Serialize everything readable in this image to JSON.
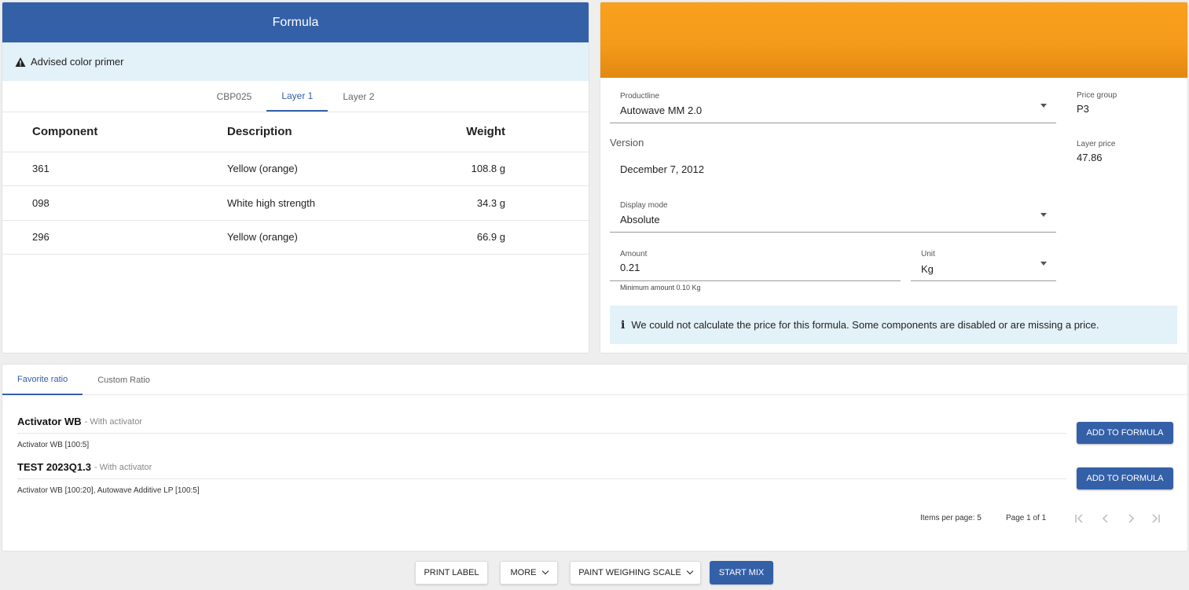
{
  "formula": {
    "title": "Formula",
    "alert": "Advised color primer",
    "tabs": [
      "CBP025",
      "Layer 1",
      "Layer 2"
    ],
    "active_tab": "Layer 1",
    "columns": [
      "Component",
      "Description",
      "Weight"
    ],
    "rows": [
      {
        "component": "361",
        "description": "Yellow (orange)",
        "weight": "108.8 g"
      },
      {
        "component": "098",
        "description": "White high strength",
        "weight": "34.3 g"
      },
      {
        "component": "296",
        "description": "Yellow (orange)",
        "weight": "66.9 g"
      }
    ]
  },
  "settings": {
    "swatch_color": "#f49b1a",
    "productline_label": "Productline",
    "productline_value": "Autowave MM 2.0",
    "version_label": "Version",
    "version_value": "December 7, 2012",
    "display_mode_label": "Display mode",
    "display_mode_value": "Absolute",
    "amount_label": "Amount",
    "amount_value": "0.21",
    "unit_label": "Unit",
    "unit_value": "Kg",
    "min_amount_hint": "Minimum amount 0.10 Kg",
    "price_group_label": "Price group",
    "price_group_value": "P3",
    "layer_price_label": "Layer price",
    "layer_price_value": "47.86",
    "info_message": "We could not calculate the price for this formula. Some components are disabled or are missing a price."
  },
  "ratios": {
    "tabs": [
      "Favorite ratio",
      "Custom Ratio"
    ],
    "active_tab": "Favorite ratio",
    "items": [
      {
        "name": "Activator WB",
        "subtitle": "- With activator",
        "detail": "Activator WB [100:5]",
        "button": "ADD TO FORMULA"
      },
      {
        "name": "TEST 2023Q1.3",
        "subtitle": "- With activator",
        "detail": "Activator WB [100:20], Autowave Additive LP [100:5]",
        "button": "ADD TO FORMULA"
      }
    ],
    "items_per_page_label": "Items per page: 5",
    "page_label": "Page 1 of 1"
  },
  "actions": {
    "print_label": "PRINT LABEL",
    "more": "MORE",
    "paint_scale": "PAINT WEIGHING SCALE",
    "start_mix": "START MIX"
  },
  "colors": {
    "primary": "#3460a8",
    "info_bg": "#e3f1f8"
  }
}
